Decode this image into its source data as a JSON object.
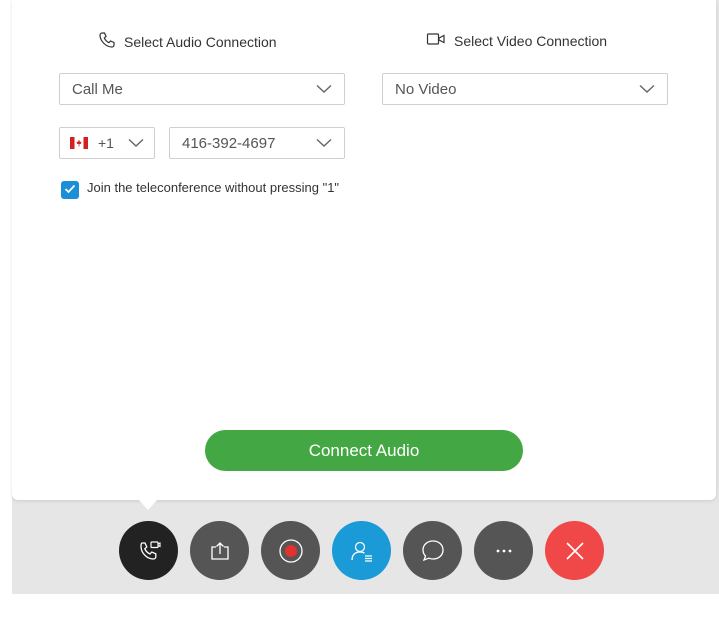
{
  "audio": {
    "header": "Select Audio Connection",
    "icon": "phone-icon",
    "selected": "Call Me",
    "country_code": "+1",
    "country_flag": "canada-flag-icon",
    "phone_number": "416-392-4697"
  },
  "video": {
    "header": "Select Video Connection",
    "icon": "camera-icon",
    "selected": "No Video"
  },
  "checkbox": {
    "checked": true,
    "label": "Join the teleconference without pressing \"1\""
  },
  "connect_label": "Connect Audio",
  "toolbar": [
    {
      "name": "audio-connection-button",
      "icon": "audio-call-icon",
      "color": "#222222"
    },
    {
      "name": "share-button",
      "icon": "share-upload-icon",
      "color": "#555555"
    },
    {
      "name": "record-button",
      "icon": "record-icon",
      "color": "#555555"
    },
    {
      "name": "participants-button",
      "icon": "participants-icon",
      "color": "#1a9ad6"
    },
    {
      "name": "chat-button",
      "icon": "chat-bubble-icon",
      "color": "#555555"
    },
    {
      "name": "more-options-button",
      "icon": "more-icon",
      "color": "#555555"
    },
    {
      "name": "leave-meeting-button",
      "icon": "close-icon",
      "color": "#f04848"
    }
  ],
  "colors": {
    "accent_blue": "#1a8fd8",
    "connect_green": "#43a843",
    "end_red": "#f04848",
    "toolbar_gray": "#555555"
  }
}
